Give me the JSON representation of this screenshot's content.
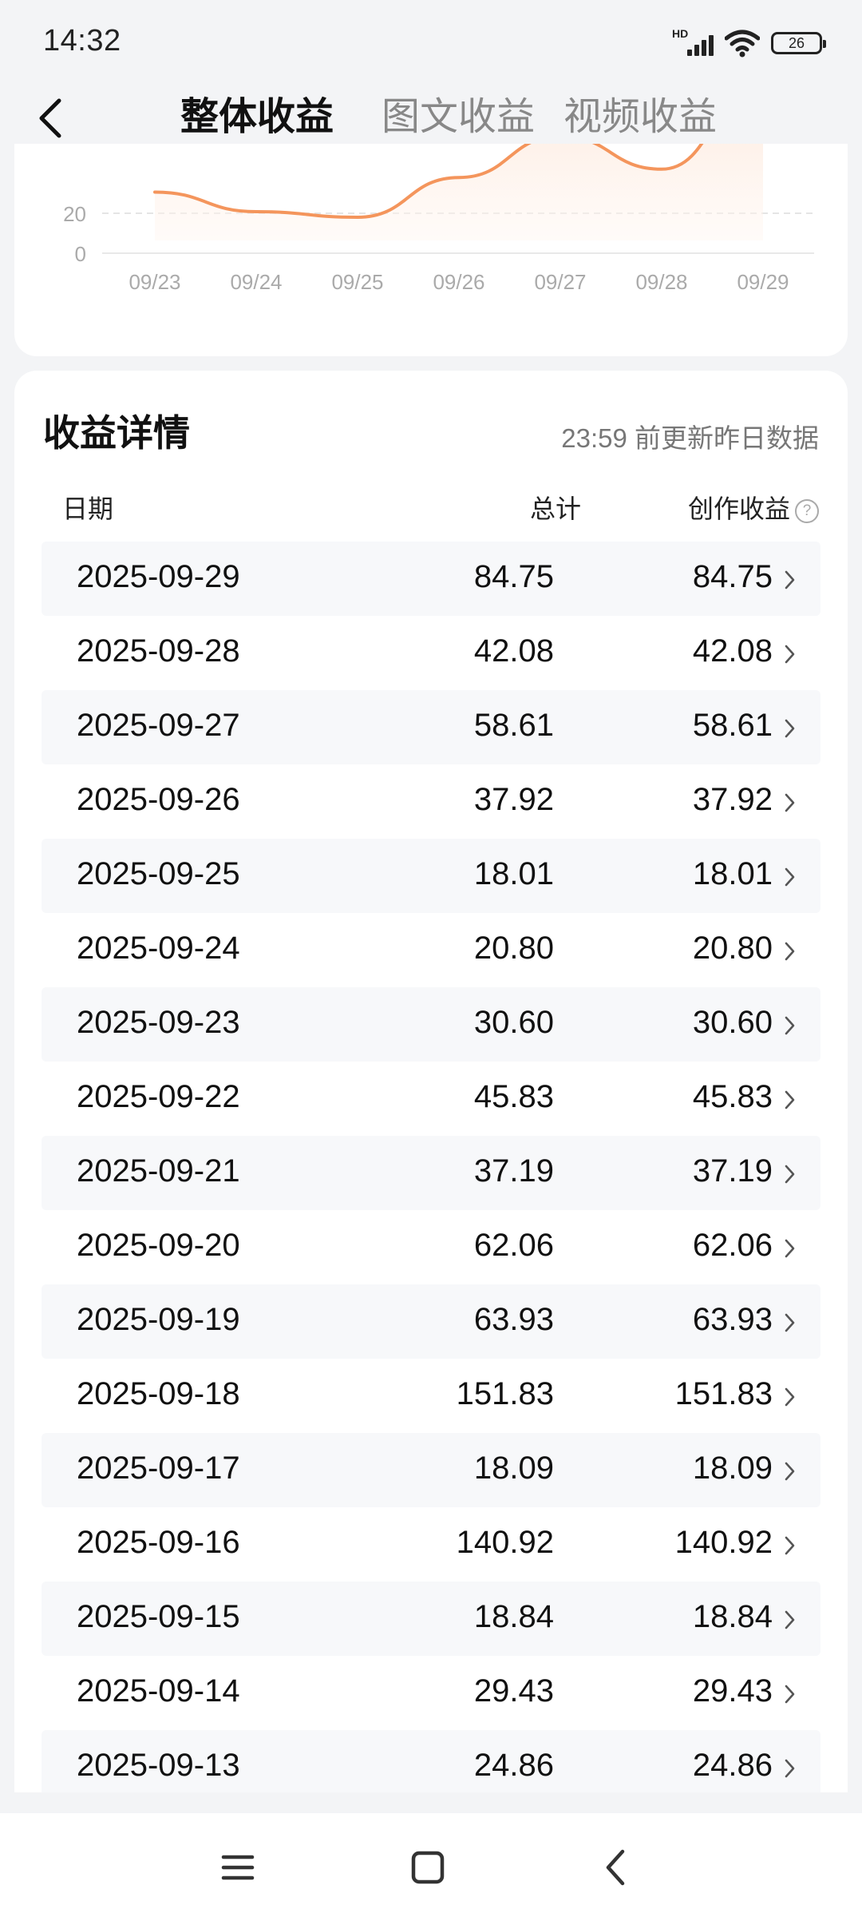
{
  "status_bar": {
    "time": "14:32",
    "network": "HD",
    "battery": "26"
  },
  "tabs": [
    {
      "label": "整体收益",
      "active": true
    },
    {
      "label": "图文收益",
      "active": false
    },
    {
      "label": "视频收益",
      "active": false
    }
  ],
  "chart_data": {
    "type": "area",
    "categories": [
      "09/23",
      "09/24",
      "09/25",
      "09/26",
      "09/27",
      "09/28",
      "09/29"
    ],
    "y_ticks": [
      "20",
      "0"
    ],
    "series": [
      {
        "values": [
          30.6,
          20.8,
          18.01,
          37.92,
          58.61,
          42.08,
          84.75
        ]
      }
    ],
    "grid": true,
    "line_color": "#f4955c"
  },
  "details": {
    "title": "收益详情",
    "update_note": "23:59 前更新昨日数据",
    "headers": {
      "date": "日期",
      "total": "总计",
      "earnings": "创作收益"
    },
    "help_icon": "?",
    "rows": [
      {
        "date": "2025-09-29",
        "total": "84.75",
        "earnings": "84.75"
      },
      {
        "date": "2025-09-28",
        "total": "42.08",
        "earnings": "42.08"
      },
      {
        "date": "2025-09-27",
        "total": "58.61",
        "earnings": "58.61"
      },
      {
        "date": "2025-09-26",
        "total": "37.92",
        "earnings": "37.92"
      },
      {
        "date": "2025-09-25",
        "total": "18.01",
        "earnings": "18.01"
      },
      {
        "date": "2025-09-24",
        "total": "20.80",
        "earnings": "20.80"
      },
      {
        "date": "2025-09-23",
        "total": "30.60",
        "earnings": "30.60"
      },
      {
        "date": "2025-09-22",
        "total": "45.83",
        "earnings": "45.83"
      },
      {
        "date": "2025-09-21",
        "total": "37.19",
        "earnings": "37.19"
      },
      {
        "date": "2025-09-20",
        "total": "62.06",
        "earnings": "62.06"
      },
      {
        "date": "2025-09-19",
        "total": "63.93",
        "earnings": "63.93"
      },
      {
        "date": "2025-09-18",
        "total": "151.83",
        "earnings": "151.83"
      },
      {
        "date": "2025-09-17",
        "total": "18.09",
        "earnings": "18.09"
      },
      {
        "date": "2025-09-16",
        "total": "140.92",
        "earnings": "140.92"
      },
      {
        "date": "2025-09-15",
        "total": "18.84",
        "earnings": "18.84"
      },
      {
        "date": "2025-09-14",
        "total": "29.43",
        "earnings": "29.43"
      },
      {
        "date": "2025-09-13",
        "total": "24.86",
        "earnings": "24.86"
      }
    ]
  },
  "icons": {
    "back": "back-arrow-icon",
    "row_chevron": "chevron-right-icon",
    "nav": [
      "menu-icon",
      "home-square-icon",
      "back-triangle-icon"
    ]
  }
}
